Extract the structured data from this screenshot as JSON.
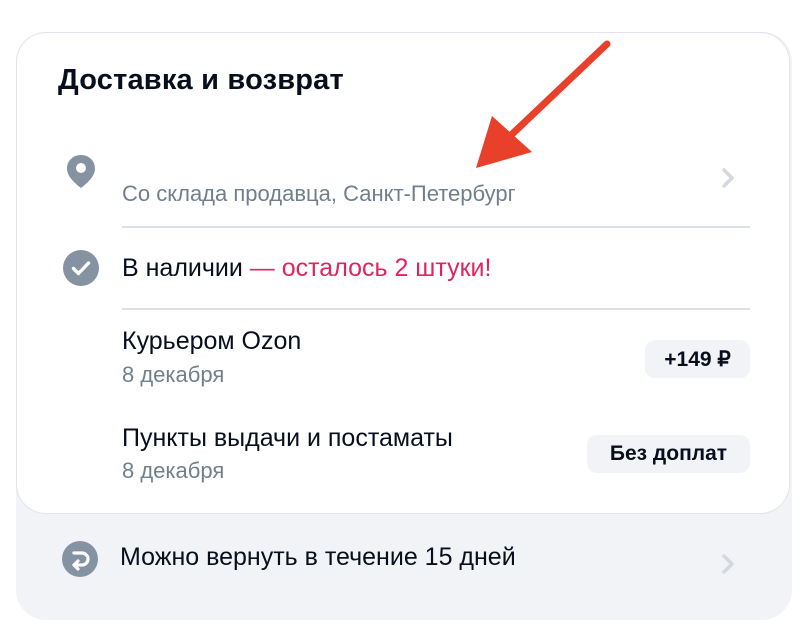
{
  "section": {
    "title": "Доставка и возврат"
  },
  "location": {
    "icon": "location-pin-icon",
    "subtitle": "Со склада продавца, Санкт-Петербург"
  },
  "stock": {
    "icon": "check-circle-icon",
    "label": "В наличии",
    "accent_text": " — осталось 2 штуки!",
    "accent_color": "#e0245e"
  },
  "delivery_options": [
    {
      "title": "Курьером Ozon",
      "date": "8 декабря",
      "price": "+149 ₽"
    },
    {
      "title": "Пункты выдачи и постаматы",
      "date": "8 декабря",
      "price": "Без доплат"
    }
  ],
  "return": {
    "icon": "return-arrow-icon",
    "label": "Можно вернуть в течение 15 дней"
  },
  "annotation": {
    "icon": "red-arrow-icon",
    "color": "#e8402a"
  },
  "colors": {
    "text_primary": "#070e1c",
    "text_secondary": "#707f8d",
    "icon_gray": "#8592a1",
    "panel_bg": "#f2f3f7"
  }
}
